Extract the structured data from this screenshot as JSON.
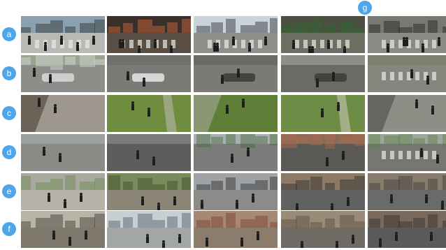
{
  "row_labels": [
    "a",
    "b",
    "c",
    "d",
    "e",
    "f"
  ],
  "column_label": "g",
  "colors": {
    "badge": "#4da6ea",
    "background": "#ffffff"
  },
  "thumbnails": [
    [
      {
        "scene": "crosswalk-people",
        "sky": "#8aa2b0",
        "ground": "#b9b9b6",
        "accent": "#2b2b2b"
      },
      {
        "scene": "night-street-crowd",
        "sky": "#3a2f2a",
        "ground": "#5a4d44",
        "accent": "#d66a3a"
      },
      {
        "scene": "city-street-crowd",
        "sky": "#c9d3dc",
        "ground": "#8f8f8c",
        "accent": "#2c2c2c"
      },
      {
        "scene": "synthetic-plaza-crowd",
        "sky": "#4b4e40",
        "ground": "#6e6f63",
        "accent": "#2e6a2e"
      },
      {
        "scene": "synthetic-crosswalk",
        "sky": "#777a72",
        "ground": "#8b8b85",
        "accent": "#1f1f1f"
      }
    ],
    [
      {
        "scene": "parked-cars-street",
        "sky": "#9aa48c",
        "ground": "#8d8d8a",
        "accent": "#d9d9d9"
      },
      {
        "scene": "white-car-road",
        "sky": "#6f6f6c",
        "ground": "#7a7a77",
        "accent": "#e6e6e6"
      },
      {
        "scene": "empty-asphalt",
        "sky": "#6b6b66",
        "ground": "#7b7a75",
        "accent": "#3a3a3a"
      },
      {
        "scene": "synthetic-building-car",
        "sky": "#8e8e88",
        "ground": "#6a6a66",
        "accent": "#3c3c3c"
      },
      {
        "scene": "synthetic-road-crossing",
        "sky": "#7c8070",
        "ground": "#86867f",
        "accent": "#e1e1dc"
      }
    ],
    [
      {
        "scene": "pavement-topdown",
        "sky": "#a19b92",
        "ground": "#9d978d",
        "accent": "#4a3f36"
      },
      {
        "scene": "grass-field",
        "sky": "#6e8a3e",
        "ground": "#6f8c3f",
        "accent": "#b7b7ad"
      },
      {
        "scene": "park-path-trees",
        "sky": "#4f6a36",
        "ground": "#5f7f39",
        "accent": "#a6a69a"
      },
      {
        "scene": "synthetic-grass",
        "sky": "#6b8a42",
        "ground": "#6d8c45",
        "accent": "#c9c4b4"
      },
      {
        "scene": "synthetic-pavement",
        "sky": "#8c8b84",
        "ground": "#8e8d86",
        "accent": "#4d4d49"
      }
    ],
    [
      {
        "scene": "plaza-trees-overhead",
        "sky": "#9aa1a0",
        "ground": "#8a8b86",
        "accent": "#3d4d34"
      },
      {
        "scene": "street-cars-overhead",
        "sky": "#7c7c7a",
        "ground": "#5c5d5c",
        "accent": "#e8e8e8"
      },
      {
        "scene": "road-trees-overhead",
        "sky": "#a8b0b4",
        "ground": "#7b7c79",
        "accent": "#4a6a3a"
      },
      {
        "scene": "synthetic-buildings-street",
        "sky": "#8a6a5a",
        "ground": "#5c5a56",
        "accent": "#b06a4a"
      },
      {
        "scene": "synthetic-intersection",
        "sky": "#9aa89a",
        "ground": "#767673",
        "accent": "#5f7f47"
      }
    ],
    [
      {
        "scene": "sidewalk-walkers",
        "sky": "#a8aaa0",
        "ground": "#b5b2a8",
        "accent": "#6b8a4a"
      },
      {
        "scene": "tree-lined-sidewalk",
        "sky": "#7a8a5a",
        "ground": "#8a8576",
        "accent": "#3a4a2a"
      },
      {
        "scene": "road-pedestrian",
        "sky": "#9fa3a6",
        "ground": "#8b8c8a",
        "accent": "#2a2a2a"
      },
      {
        "scene": "synthetic-city-block",
        "sky": "#8c7a66",
        "ground": "#616161",
        "accent": "#2b2b2b"
      },
      {
        "scene": "synthetic-city-street",
        "sky": "#8a7c6c",
        "ground": "#6a6a68",
        "accent": "#3b3b3b"
      }
    ],
    [
      {
        "scene": "old-town-street",
        "sky": "#b8b4a8",
        "ground": "#7d776c",
        "accent": "#3b332c"
      },
      {
        "scene": "shopfront-sidewalk",
        "sky": "#c8cfd2",
        "ground": "#a3a6a6",
        "accent": "#4a5a6a"
      },
      {
        "scene": "european-street",
        "sky": "#a48a74",
        "ground": "#8b7c6c",
        "accent": "#7a3a2a"
      },
      {
        "scene": "synthetic-street-wide",
        "sky": "#9a8a78",
        "ground": "#6f6a63",
        "accent": "#5a4a3a"
      },
      {
        "scene": "synthetic-street-people",
        "sky": "#7a6a5e",
        "ground": "#5b5a58",
        "accent": "#2c2c2c"
      }
    ]
  ]
}
